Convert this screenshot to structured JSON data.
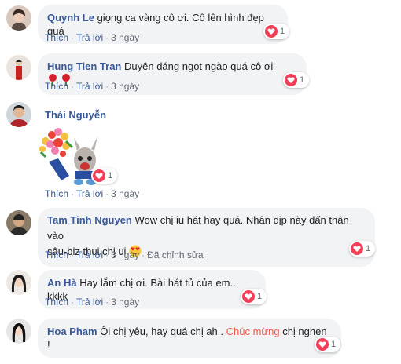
{
  "actions": {
    "like": "Thích",
    "reply": "Trả lời",
    "edited": "Đã chỉnh sửa"
  },
  "comments": [
    {
      "name": "Quynh Le",
      "text": "giọng ca vàng cô ơi. Cô lên hình đẹp quá",
      "time": "3 ngày",
      "reactions": "1"
    },
    {
      "name": "Hung Tien Tran",
      "text": "Duyên dáng ngọt ngào quá cô ơi",
      "time": "3 ngày",
      "reactions": "1"
    },
    {
      "name": "Thái Nguyễn",
      "time": "3 ngày",
      "reactions": "1"
    },
    {
      "name": "Tam Tinh Nguyen",
      "text_line1": "Wow chị iu hát hay quá. Nhân dịp này dấn thân vào",
      "text_line2": "sâu-biz thui chị ui",
      "time": "3 ngày",
      "reactions": "1"
    },
    {
      "name": "An Hà",
      "text": "Hay lắm chị ơi. Bài hát tủ của em... kkkk",
      "time": "3 ngày",
      "reactions": "1"
    },
    {
      "name": "Hoa Pham",
      "text_before": "Ôi chị yêu, hay quá chị ah . ",
      "text_highlight": "Chúc mừng",
      "text_after": " chị nghen !",
      "reactions": "1"
    }
  ],
  "colors": {
    "name": "#385898",
    "bubble": "#f2f3f5",
    "heart": "#f33e58",
    "highlight": "#f0594a"
  }
}
